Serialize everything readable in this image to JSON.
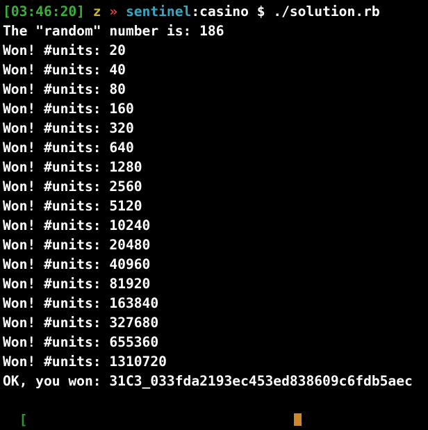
{
  "colors": {
    "background": "#000000",
    "text": "#ffffff",
    "timestamp": "#3cb039",
    "user": "#c9b531",
    "separator": "#e0443c",
    "host": "#39a7c2",
    "cursor": "#f0a030"
  },
  "prompt": {
    "timestamp": "[03:46:20]",
    "user": "z",
    "separator": "»",
    "host": "sentinel",
    "path": ":casino",
    "symbol": "$",
    "command": "./solution.rb"
  },
  "output": [
    "The \"random\" number is: 186",
    "Won! #units: 20",
    "Won! #units: 40",
    "Won! #units: 80",
    "Won! #units: 160",
    "Won! #units: 320",
    "Won! #units: 640",
    "Won! #units: 1280",
    "Won! #units: 2560",
    "Won! #units: 5120",
    "Won! #units: 10240",
    "Won! #units: 20480",
    "Won! #units: 40960",
    "Won! #units: 81920",
    "Won! #units: 163840",
    "Won! #units: 327680",
    "Won! #units: 655360",
    "Won! #units: 1310720",
    "OK, you won: 31C3_033fda2193ec453ed838609c6fdb5aec"
  ]
}
